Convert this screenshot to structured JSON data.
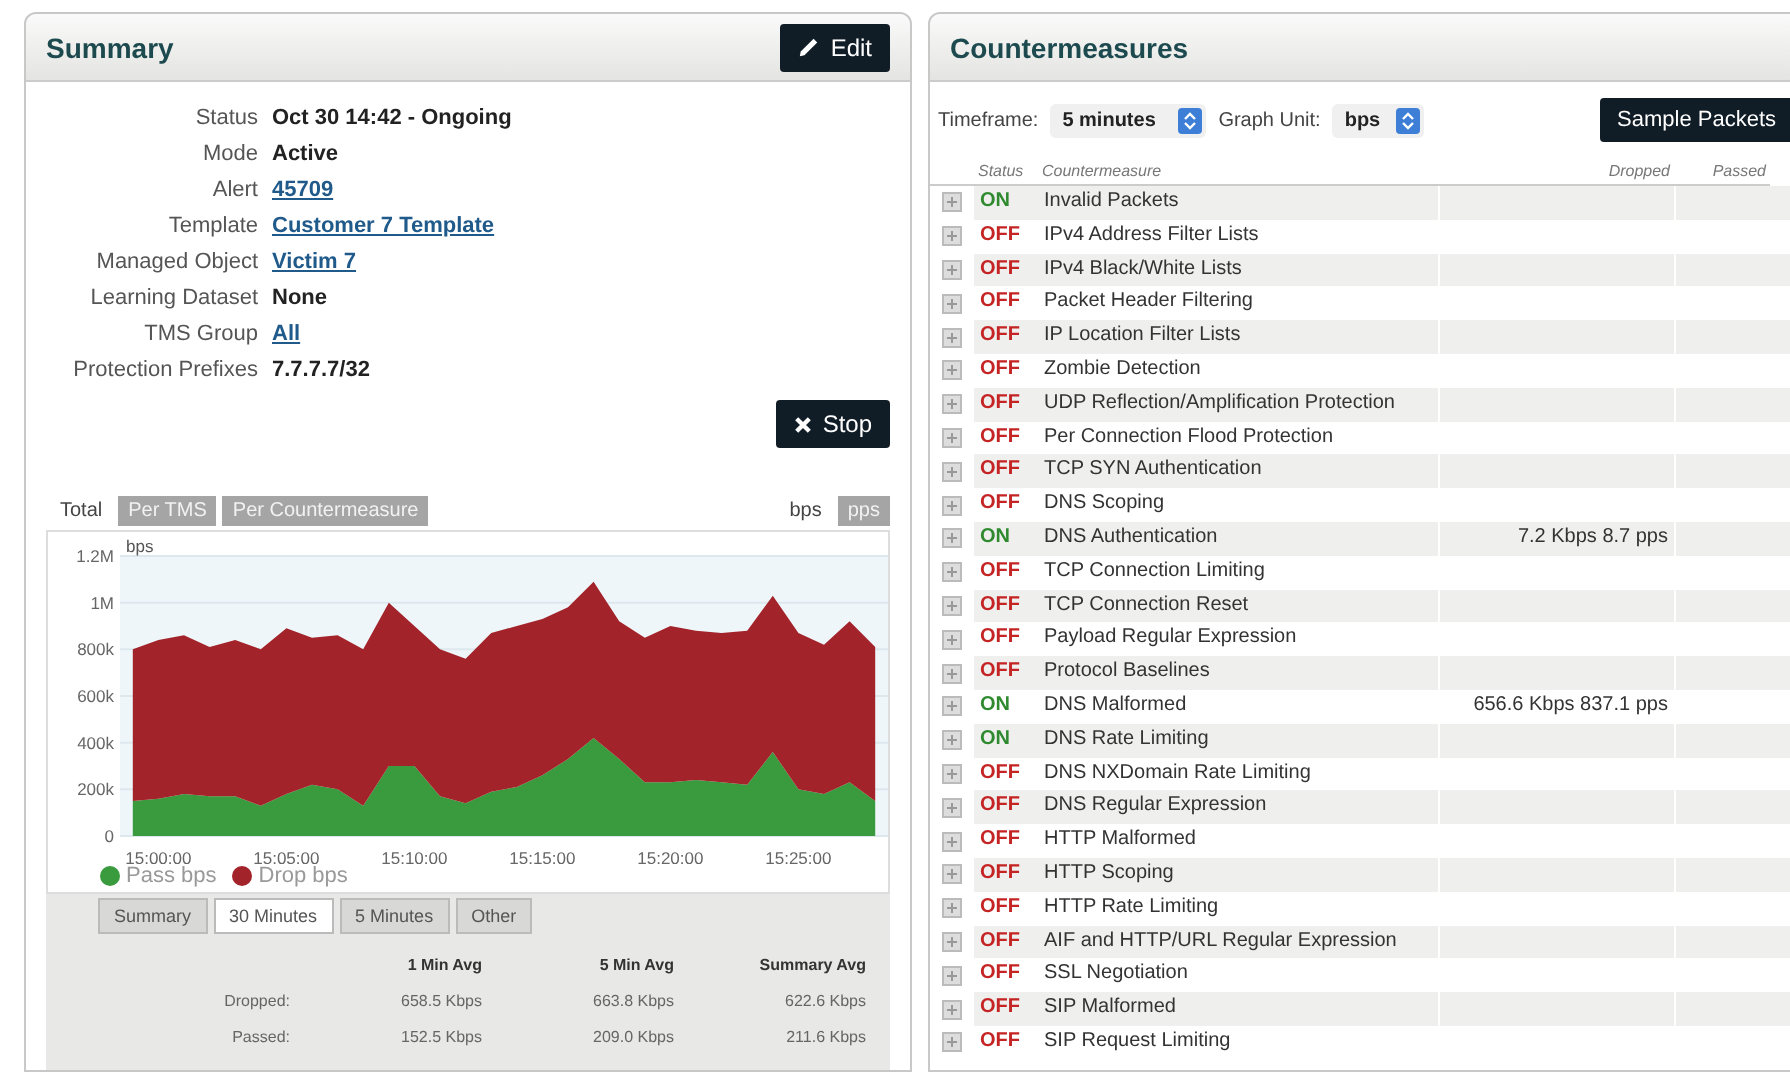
{
  "summary": {
    "title": "Summary",
    "edit_button": "Edit",
    "fields": [
      {
        "label": "Status",
        "value": "Oct 30 14:42 - Ongoing",
        "kind": "text"
      },
      {
        "label": "Mode",
        "value": "Active",
        "kind": "text"
      },
      {
        "label": "Alert",
        "value": "45709",
        "kind": "link"
      },
      {
        "label": "Template",
        "value": "Customer 7 Template",
        "kind": "link"
      },
      {
        "label": "Managed Object",
        "value": "Victim 7",
        "kind": "link"
      },
      {
        "label": "Learning Dataset",
        "value": "None",
        "kind": "text"
      },
      {
        "label": "TMS Group",
        "value": "All",
        "kind": "link"
      },
      {
        "label": "Protection Prefixes",
        "value": "7.7.7.7/32",
        "kind": "text"
      }
    ],
    "stop_button": "Stop",
    "view_tabs": [
      {
        "label": "Total",
        "selected": true
      },
      {
        "label": "Per TMS",
        "selected": false
      },
      {
        "label": "Per Countermeasure",
        "selected": false
      }
    ],
    "unit_tabs": [
      {
        "label": "bps",
        "selected": true
      },
      {
        "label": "pps",
        "selected": false
      }
    ],
    "chart_data": {
      "type": "area",
      "stacked": true,
      "ylabel": "bps",
      "grid": true,
      "legend": true,
      "ylim": [
        0,
        1200000
      ],
      "yticks": [
        {
          "value": 0,
          "label": "0"
        },
        {
          "value": 200000,
          "label": "200k"
        },
        {
          "value": 400000,
          "label": "400k"
        },
        {
          "value": 600000,
          "label": "600k"
        },
        {
          "value": 800000,
          "label": "800k"
        },
        {
          "value": 1000000,
          "label": "1M"
        },
        {
          "value": 1200000,
          "label": "1.2M"
        }
      ],
      "categories": [
        null,
        "15:00:00",
        null,
        null,
        null,
        null,
        "15:05:00",
        null,
        null,
        null,
        null,
        "15:10:00",
        null,
        null,
        null,
        null,
        "15:15:00",
        null,
        null,
        null,
        null,
        "15:20:00",
        null,
        null,
        null,
        null,
        "15:25:00",
        null,
        null,
        null
      ],
      "series": [
        {
          "name": "Pass bps",
          "color": "#3a9a3e",
          "values": [
            150000,
            160000,
            180000,
            170000,
            170000,
            130000,
            180000,
            220000,
            200000,
            130000,
            300000,
            300000,
            170000,
            140000,
            190000,
            210000,
            260000,
            330000,
            420000,
            330000,
            230000,
            230000,
            240000,
            230000,
            220000,
            360000,
            200000,
            180000,
            230000,
            150000
          ]
        },
        {
          "name": "Drop bps",
          "color": "#a3232a",
          "values": [
            650000,
            680000,
            680000,
            640000,
            670000,
            670000,
            710000,
            630000,
            660000,
            670000,
            700000,
            600000,
            630000,
            620000,
            680000,
            690000,
            670000,
            650000,
            670000,
            590000,
            620000,
            670000,
            640000,
            640000,
            660000,
            670000,
            670000,
            640000,
            690000,
            660000
          ]
        }
      ]
    },
    "range_tabs": [
      {
        "label": "Summary",
        "selected": false
      },
      {
        "label": "30 Minutes",
        "selected": true
      },
      {
        "label": "5 Minutes",
        "selected": false
      },
      {
        "label": "Other",
        "selected": false
      }
    ],
    "stats": {
      "columns": [
        "1 Min Avg",
        "5 Min Avg",
        "Summary Avg"
      ],
      "rows": [
        {
          "label": "Dropped:",
          "values": [
            "658.5 Kbps",
            "663.8 Kbps",
            "622.6 Kbps"
          ]
        },
        {
          "label": "Passed:",
          "values": [
            "152.5 Kbps",
            "209.0 Kbps",
            "211.6 Kbps"
          ]
        }
      ]
    }
  },
  "countermeasures": {
    "title": "Countermeasures",
    "timeframe_label": "Timeframe:",
    "timeframe": "5 minutes",
    "graph_unit_label": "Graph Unit:",
    "graph_unit": "bps",
    "sample_button": "Sample Packets",
    "columns": [
      "Status",
      "Countermeasure",
      "Dropped",
      "Passed"
    ],
    "rows": [
      {
        "on": true,
        "status": "ON",
        "name": "Invalid Packets"
      },
      {
        "on": false,
        "status": "OFF",
        "name": "IPv4 Address Filter Lists"
      },
      {
        "on": false,
        "status": "OFF",
        "name": "IPv4 Black/White Lists"
      },
      {
        "on": false,
        "status": "OFF",
        "name": "Packet Header Filtering"
      },
      {
        "on": false,
        "status": "OFF",
        "name": "IP Location Filter Lists"
      },
      {
        "on": false,
        "status": "OFF",
        "name": "Zombie Detection"
      },
      {
        "on": false,
        "status": "OFF",
        "name": "UDP Reflection/Amplification Protection"
      },
      {
        "on": false,
        "status": "OFF",
        "name": "Per Connection Flood Protection"
      },
      {
        "on": false,
        "status": "OFF",
        "name": "TCP SYN Authentication"
      },
      {
        "on": false,
        "status": "OFF",
        "name": "DNS Scoping"
      },
      {
        "on": true,
        "status": "ON",
        "name": "DNS Authentication",
        "dropped": "7.2 Kbps 8.7 pps"
      },
      {
        "on": false,
        "status": "OFF",
        "name": "TCP Connection Limiting"
      },
      {
        "on": false,
        "status": "OFF",
        "name": "TCP Connection Reset"
      },
      {
        "on": false,
        "status": "OFF",
        "name": "Payload Regular Expression"
      },
      {
        "on": false,
        "status": "OFF",
        "name": "Protocol Baselines"
      },
      {
        "on": true,
        "status": "ON",
        "name": "DNS Malformed",
        "dropped": "656.6 Kbps 837.1 pps"
      },
      {
        "on": true,
        "status": "ON",
        "name": "DNS Rate Limiting"
      },
      {
        "on": false,
        "status": "OFF",
        "name": "DNS NXDomain Rate Limiting"
      },
      {
        "on": false,
        "status": "OFF",
        "name": "DNS Regular Expression"
      },
      {
        "on": false,
        "status": "OFF",
        "name": "HTTP Malformed"
      },
      {
        "on": false,
        "status": "OFF",
        "name": "HTTP Scoping"
      },
      {
        "on": false,
        "status": "OFF",
        "name": "HTTP Rate Limiting"
      },
      {
        "on": false,
        "status": "OFF",
        "name": "AIF and HTTP/URL Regular Expression"
      },
      {
        "on": false,
        "status": "OFF",
        "name": "SSL Negotiation"
      },
      {
        "on": false,
        "status": "OFF",
        "name": "SIP Malformed"
      },
      {
        "on": false,
        "status": "OFF",
        "name": "SIP Request Limiting"
      }
    ]
  }
}
